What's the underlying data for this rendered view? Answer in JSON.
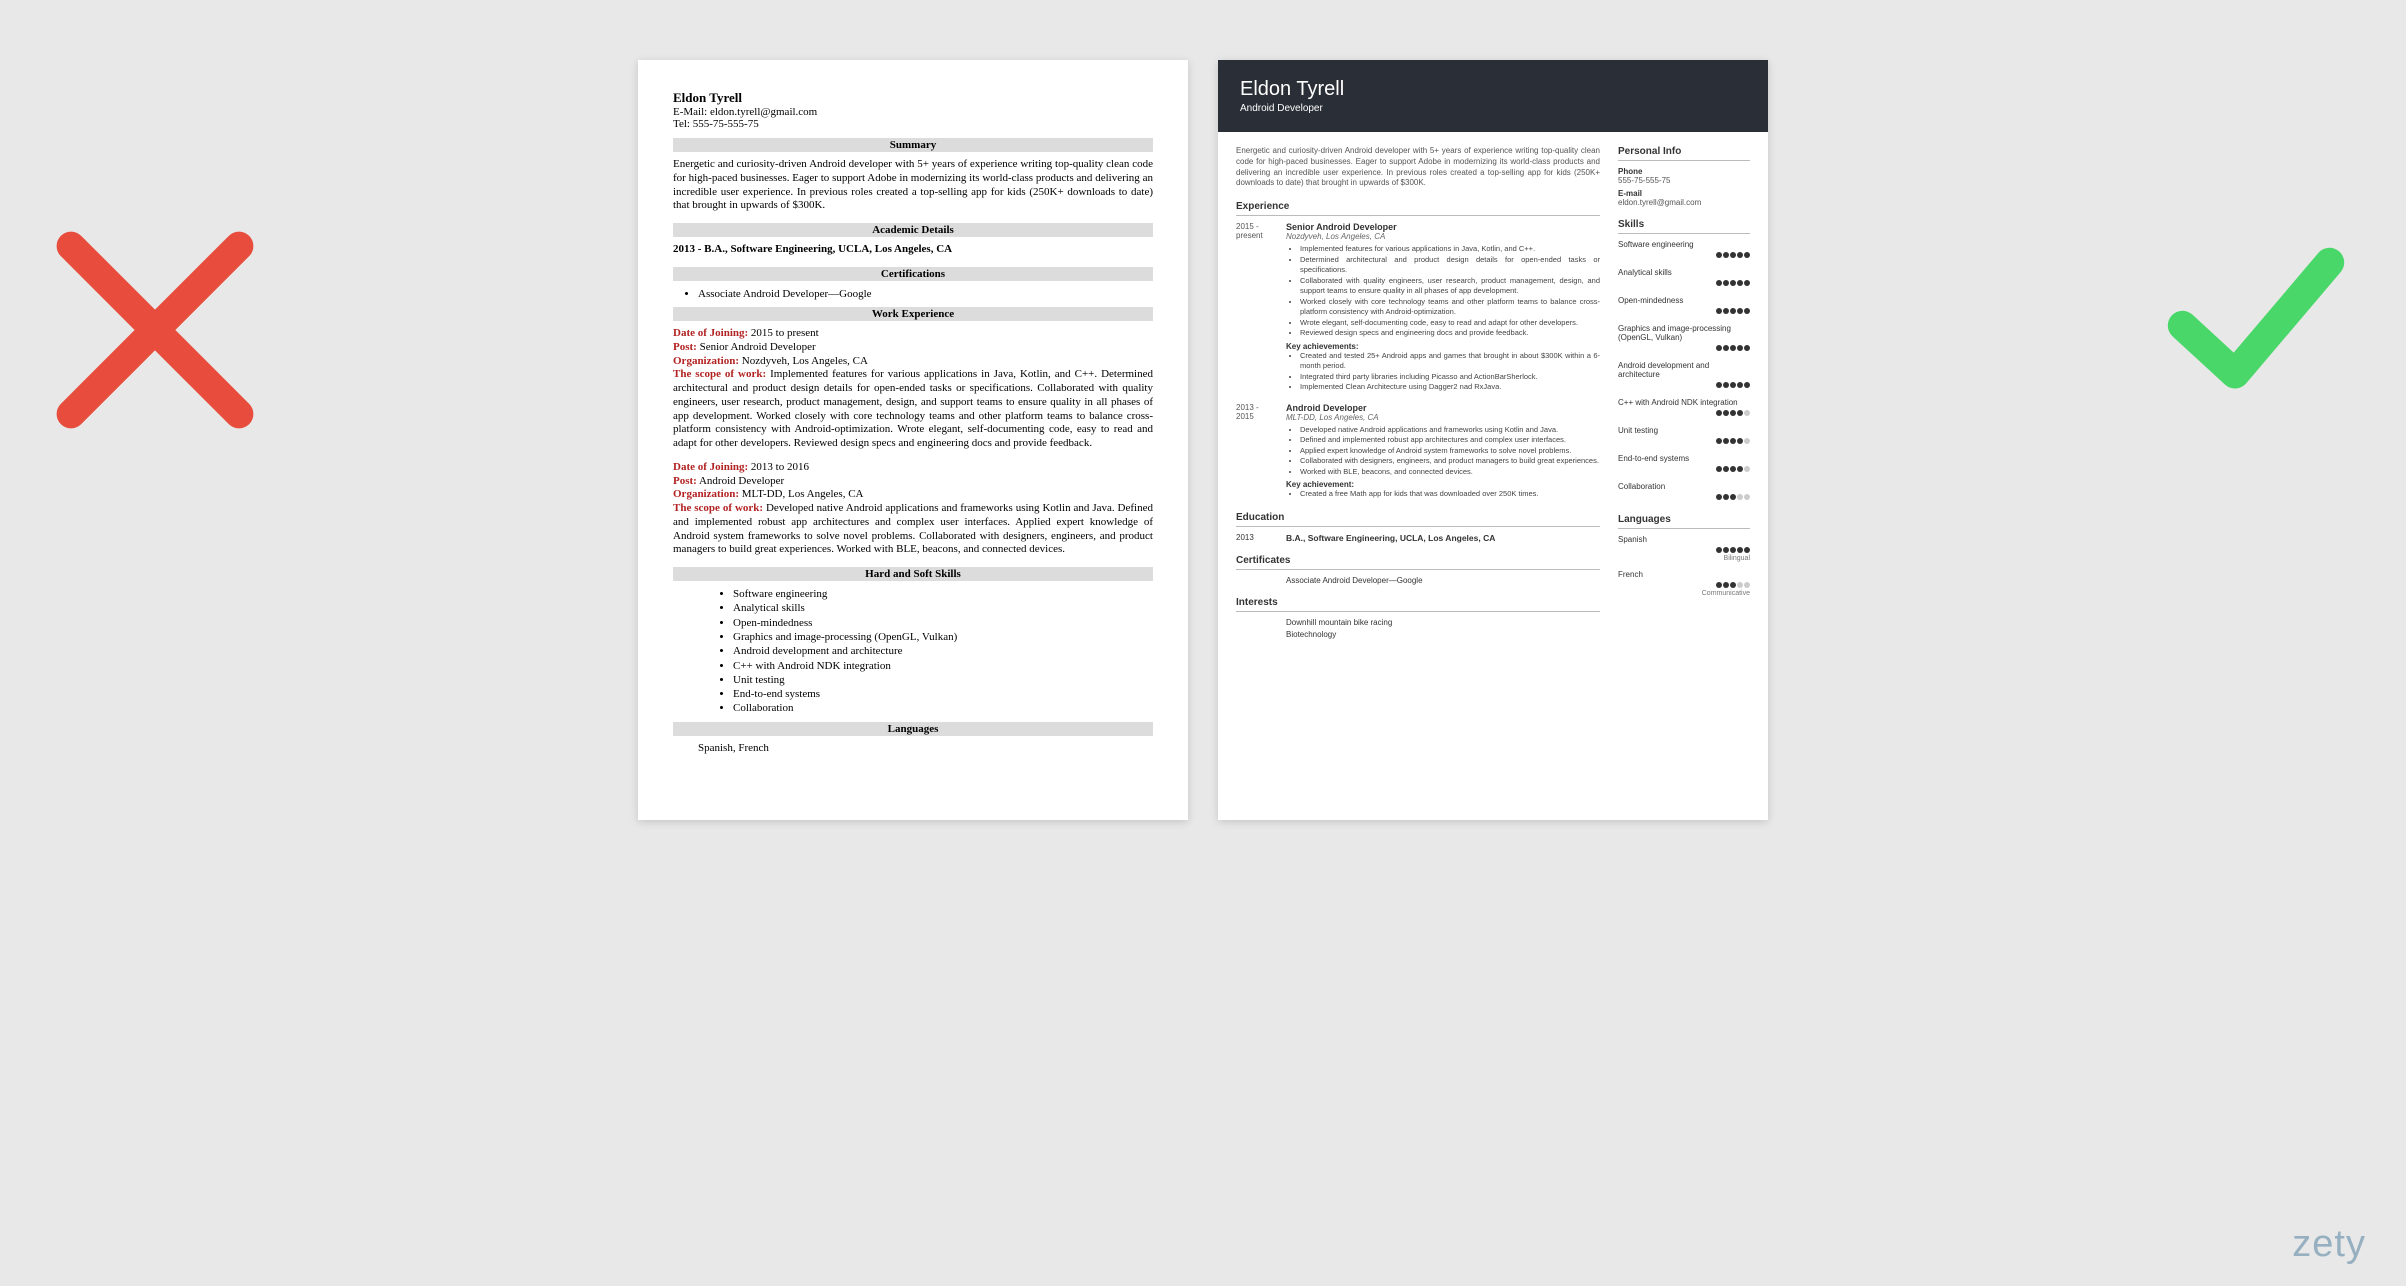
{
  "brand": "zety",
  "left": {
    "name": "Eldon Tyrell",
    "email_label": "E-Mail:",
    "email": "eldon.tyrell@gmail.com",
    "tel_label": "Tel:",
    "tel": "555-75-555-75",
    "sections": {
      "summary": "Summary",
      "academic": "Academic Details",
      "certs": "Certifications",
      "work": "Work Experience",
      "skills": "Hard and Soft Skills",
      "langs": "Languages"
    },
    "summary_text": "Energetic and curiosity-driven Android developer with 5+ years of experience writing top-quality clean code for high-paced businesses. Eager to support Adobe in modernizing its world-class products and delivering an incredible user experience. In previous roles created a top-selling app for kids (250K+ downloads to date) that brought in upwards of $300K.",
    "academic_text": "2013 - B.A., Software Engineering, UCLA, Los Angeles, CA",
    "cert_item": "Associate Android Developer—Google",
    "jobs": [
      {
        "doj_label": "Date of Joining:",
        "doj": "2015 to present",
        "post_label": "Post:",
        "post": "Senior Android Developer",
        "org_label": "Organization:",
        "org": "Nozdyveh, Los Angeles, CA",
        "scope_label": "The scope of work:",
        "scope": "Implemented features for various applications in Java, Kotlin, and C++. Determined architectural and product design details for open-ended tasks or specifications. Collaborated with quality engineers, user research, product management, design, and support teams to ensure quality in all phases of app development. Worked closely with core technology teams and other platform teams to balance cross-platform consistency with Android-optimization. Wrote elegant, self-documenting code, easy to read and adapt for other developers. Reviewed design specs and engineering docs and provide feedback."
      },
      {
        "doj_label": "Date of Joining:",
        "doj": "2013 to 2016",
        "post_label": "Post:",
        "post": "Android Developer",
        "org_label": "Organization:",
        "org": "MLT-DD, Los Angeles, CA",
        "scope_label": "The scope of work:",
        "scope": "Developed native Android applications and frameworks using Kotlin and Java. Defined and implemented robust app architectures and complex user interfaces. Applied expert knowledge of Android system frameworks to solve novel problems. Collaborated with designers, engineers, and product managers to build great experiences. Worked with BLE, beacons, and connected devices."
      }
    ],
    "skills": [
      "Software engineering",
      "Analytical skills",
      "Open-mindedness",
      "Graphics and image-processing (OpenGL, Vulkan)",
      "Android development and architecture",
      "C++ with Android NDK integration",
      "Unit testing",
      "End-to-end systems",
      "Collaboration"
    ],
    "languages_text": "Spanish, French"
  },
  "right": {
    "name": "Eldon Tyrell",
    "title": "Android Developer",
    "summary": "Energetic and curiosity-driven Android developer with 5+ years of experience writing top-quality clean code for high-paced businesses. Eager to support Adobe in modernizing its world-class products and delivering an incredible user experience. In previous roles created a top-selling app for kids (250K+ downloads to date) that brought in upwards of $300K.",
    "sec": {
      "exp": "Experience",
      "edu": "Education",
      "cert": "Certificates",
      "int": "Interests",
      "pi": "Personal Info",
      "sk": "Skills",
      "lg": "Languages"
    },
    "jobs": [
      {
        "dates": "2015 - present",
        "title": "Senior Android Developer",
        "org": "Nozdyveh, Los Angeles, CA",
        "bullets": [
          "Implemented features for various applications in Java, Kotlin, and C++.",
          "Determined architectural and product design details for open-ended tasks or specifications.",
          "Collaborated with quality engineers, user research, product management, design, and support teams to ensure quality in all phases of app development.",
          "Worked closely with core technology teams and other platform teams to balance cross-platform consistency with Android-optimization.",
          "Wrote elegant, self-documenting code, easy to read and adapt for other developers.",
          "Reviewed design specs and engineering docs and provide feedback."
        ],
        "key_label": "Key achievements:",
        "key": [
          "Created and tested 25+ Android apps and games that brought in about $300K within a 6-month period.",
          "Integrated third party libraries including Picasso and ActionBarSherlock.",
          "Implemented Clean Architecture using Dagger2 nad RxJava."
        ]
      },
      {
        "dates": "2013 - 2015",
        "title": "Android Developer",
        "org": "MLT-DD, Los Angeles, CA",
        "bullets": [
          "Developed native Android applications and frameworks using Kotlin and Java.",
          "Defined and implemented robust app architectures and complex user interfaces.",
          "Applied expert knowledge of Android system frameworks to solve novel problems.",
          "Collaborated with designers, engineers, and product managers to build great experiences.",
          "Worked with BLE, beacons, and connected devices."
        ],
        "key_label": "Key achievement:",
        "key": [
          "Created a free Math app for kids that was downloaded over 250K times."
        ]
      }
    ],
    "edu": {
      "year": "2013",
      "degree": "B.A., Software Engineering, UCLA, Los Angeles, CA"
    },
    "certs": [
      "Associate Android Developer—Google"
    ],
    "interests": [
      "Downhill mountain bike racing",
      "Biotechnology"
    ],
    "pi": {
      "phone_l": "Phone",
      "phone": "555-75-555-75",
      "email_l": "E-mail",
      "email": "eldon.tyrell@gmail.com"
    },
    "skills": [
      {
        "name": "Software engineering",
        "rating": 5
      },
      {
        "name": "Analytical skills",
        "rating": 5
      },
      {
        "name": "Open-mindedness",
        "rating": 5
      },
      {
        "name": "Graphics and image-processing (OpenGL, Vulkan)",
        "rating": 5
      },
      {
        "name": "Android development and architecture",
        "rating": 5
      },
      {
        "name": "C++ with Android NDK integration",
        "rating": 4
      },
      {
        "name": "Unit testing",
        "rating": 4
      },
      {
        "name": "End-to-end systems",
        "rating": 4
      },
      {
        "name": "Collaboration",
        "rating": 3
      }
    ],
    "langs": [
      {
        "name": "Spanish",
        "rating": 5,
        "level": "Bilingual"
      },
      {
        "name": "French",
        "rating": 3,
        "level": "Communicative"
      }
    ]
  }
}
